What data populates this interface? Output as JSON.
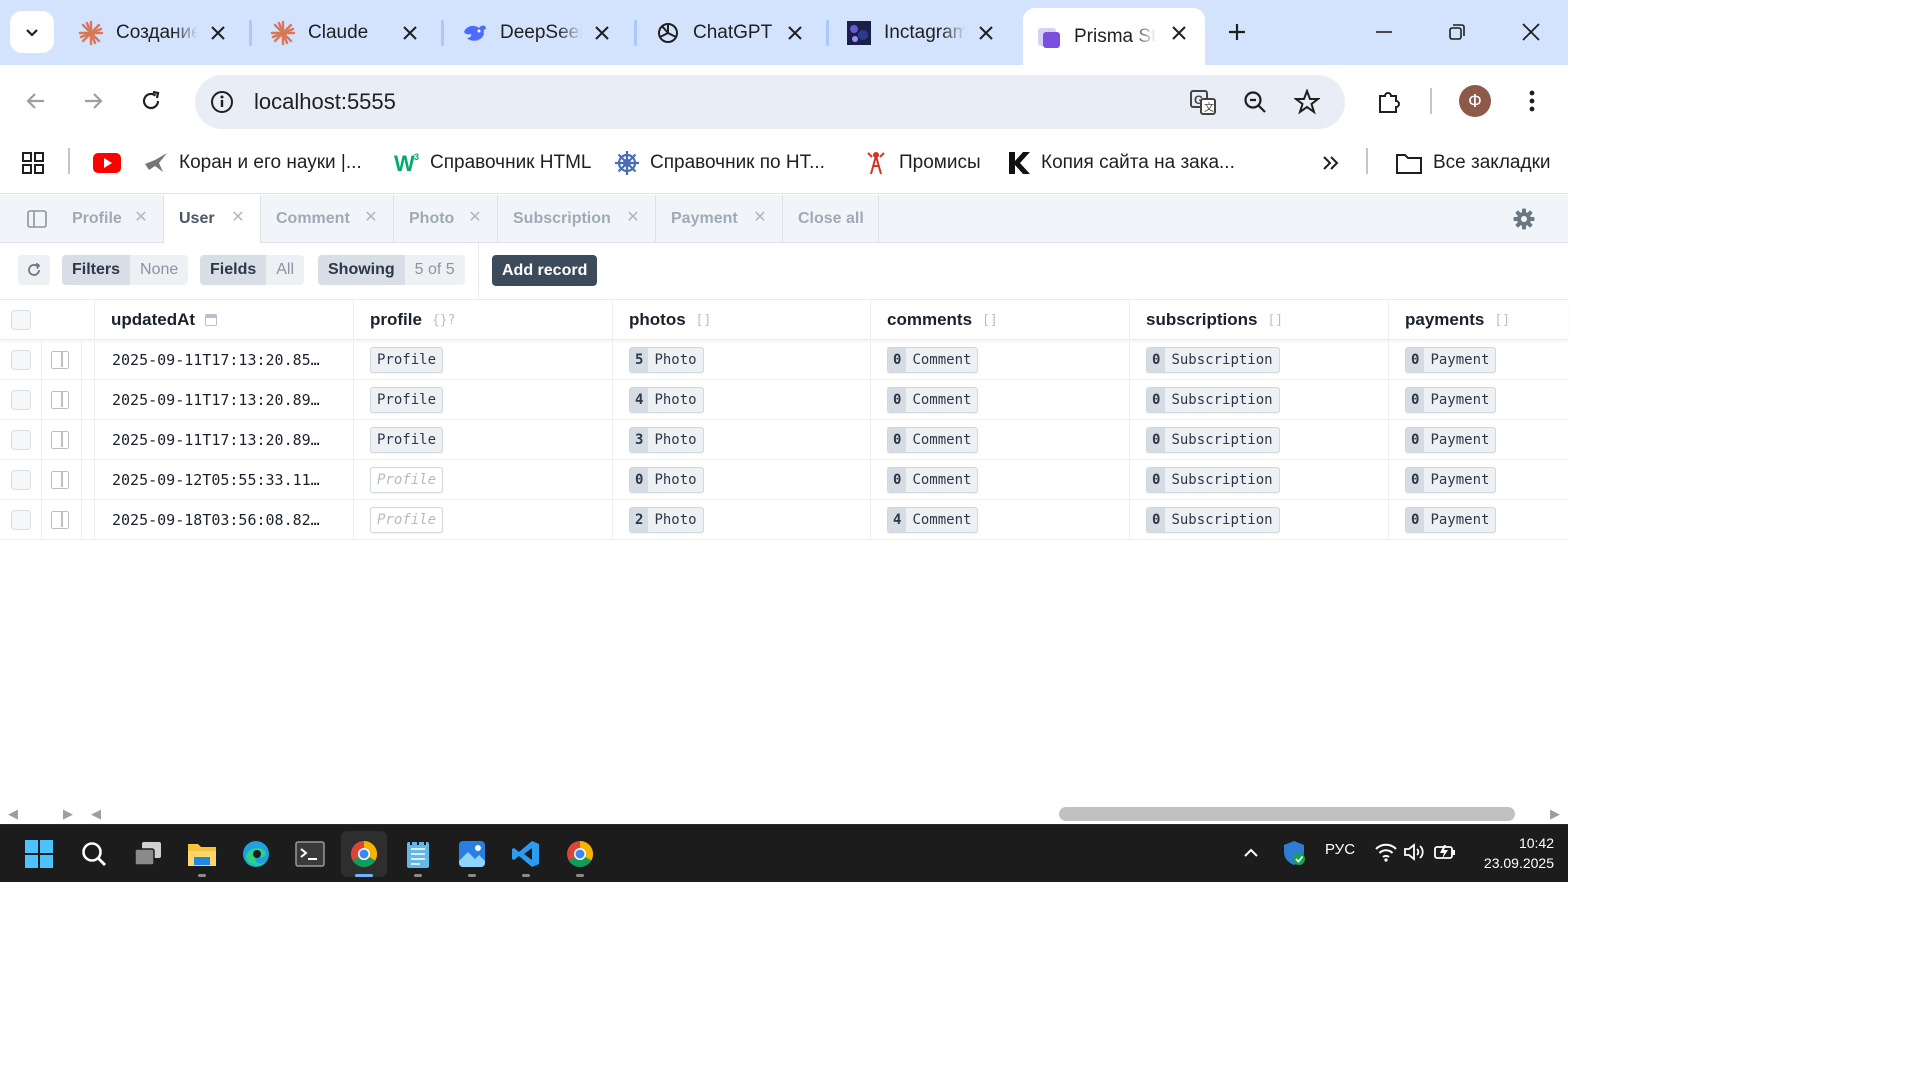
{
  "browser": {
    "tabs": [
      {
        "title": "Создание",
        "icon": "claude-icon",
        "active": false
      },
      {
        "title": "Claude",
        "icon": "claude-icon",
        "active": false
      },
      {
        "title": "DeepSeek",
        "icon": "deepseek-icon",
        "active": false
      },
      {
        "title": "ChatGPT",
        "icon": "chatgpt-icon",
        "active": false
      },
      {
        "title": "Inctagram",
        "icon": "inctagram-icon",
        "active": false
      },
      {
        "title": "Prisma Studio",
        "icon": "prisma-icon",
        "active": true
      }
    ],
    "url": "localhost:5555",
    "profile_initial": "Ф",
    "bookmarks": [
      {
        "label": "",
        "icon": "youtube-icon"
      },
      {
        "label": "Коран и его науки |...",
        "icon": "bird-icon"
      },
      {
        "label": "Справочник HTML",
        "icon": "w3-icon"
      },
      {
        "label": "Справочник по НТ...",
        "icon": "wheel-icon"
      },
      {
        "label": "Промисы",
        "icon": "tower-icon"
      },
      {
        "label": "Копия сайта на зака...",
        "icon": "k-icon"
      }
    ],
    "all_bookmarks": "Все закладки"
  },
  "studio": {
    "tabs": [
      {
        "label": "Profile",
        "active": false
      },
      {
        "label": "User",
        "active": true
      },
      {
        "label": "Comment",
        "active": false
      },
      {
        "label": "Photo",
        "active": false
      },
      {
        "label": "Subscription",
        "active": false
      },
      {
        "label": "Payment",
        "active": false
      }
    ],
    "close_all": "Close all",
    "controls": {
      "filters_label": "Filters",
      "filters_value": "None",
      "fields_label": "Fields",
      "fields_value": "All",
      "showing_label": "Showing",
      "showing_value": "5 of 5",
      "add_record": "Add record"
    },
    "columns": [
      {
        "name": "updatedAt",
        "type": ""
      },
      {
        "name": "profile",
        "type": "{}?"
      },
      {
        "name": "photos",
        "type": "[]"
      },
      {
        "name": "comments",
        "type": "[]"
      },
      {
        "name": "subscriptions",
        "type": "[]"
      },
      {
        "name": "payments",
        "type": "[]"
      }
    ],
    "rows": [
      {
        "updatedAt": "2025-09-11T17:13:20.85…",
        "profile": "Profile",
        "profile_null": false,
        "photos": "5",
        "comments": "0",
        "subscriptions": "0",
        "payments": "0"
      },
      {
        "updatedAt": "2025-09-11T17:13:20.89…",
        "profile": "Profile",
        "profile_null": false,
        "photos": "4",
        "comments": "0",
        "subscriptions": "0",
        "payments": "0"
      },
      {
        "updatedAt": "2025-09-11T17:13:20.89…",
        "profile": "Profile",
        "profile_null": false,
        "photos": "3",
        "comments": "0",
        "subscriptions": "0",
        "payments": "0"
      },
      {
        "updatedAt": "2025-09-12T05:55:33.11…",
        "profile": "Profile",
        "profile_null": true,
        "photos": "0",
        "comments": "0",
        "subscriptions": "0",
        "payments": "0"
      },
      {
        "updatedAt": "2025-09-18T03:56:08.82…",
        "profile": "Profile",
        "profile_null": true,
        "photos": "2",
        "comments": "4",
        "subscriptions": "0",
        "payments": "0"
      }
    ],
    "relation_labels": {
      "photos": "Photo",
      "comments": "Comment",
      "subscriptions": "Subscription",
      "payments": "Payment"
    }
  },
  "taskbar": {
    "language": "РУС",
    "time": "10:42",
    "date": "23.09.2025"
  },
  "colors": {
    "accent": "#d3e3fd",
    "studio_button": "#3c4a5c"
  }
}
